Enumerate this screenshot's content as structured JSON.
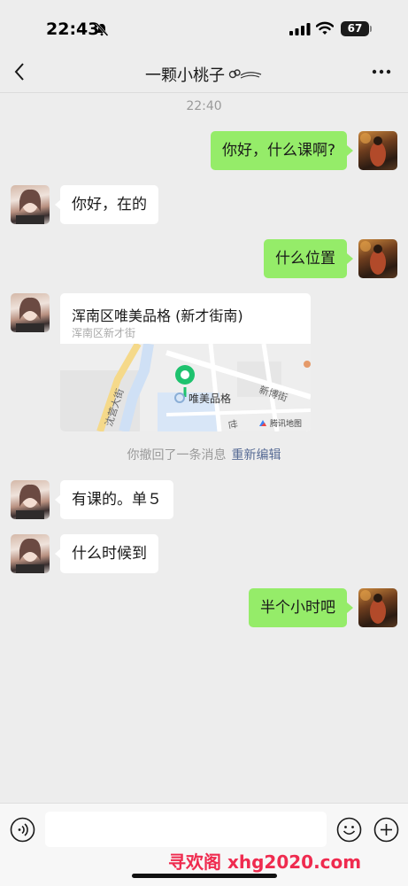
{
  "status_bar": {
    "time": "22:43",
    "battery": "67"
  },
  "nav": {
    "title": "一颗小桃子"
  },
  "chat": {
    "timestamp": "22:40",
    "messages": [
      {
        "from": "self",
        "text": "你好，什么课啊?"
      },
      {
        "from": "other",
        "text": "你好，在的"
      },
      {
        "from": "self",
        "text": "什么位置"
      },
      {
        "from": "other",
        "type": "location",
        "title": "浑南区唯美品格 (新才街南)",
        "subtitle": "浑南区新才街"
      },
      {
        "from": "other",
        "text": "有课的。单５"
      },
      {
        "from": "other",
        "text": "什么时候到"
      },
      {
        "from": "self",
        "text": "半个小时吧"
      }
    ],
    "recall_notice": "你撤回了一条消息",
    "recall_edit": "重新编辑"
  },
  "map": {
    "poi_label": "唯美品格",
    "street_labels": [
      "沈营大街",
      "新博街",
      "世"
    ],
    "attribution": "腾讯地图"
  },
  "input": {
    "placeholder": ""
  },
  "watermark": "寻欢阁 xhg2020.com",
  "colors": {
    "self_bubble": "#95ec69",
    "other_bubble": "#ffffff",
    "background": "#ededed",
    "link": "#576b95",
    "pin": "#1ec26e"
  },
  "icons": [
    "back-icon",
    "more-icon",
    "voice-icon",
    "emoji-icon",
    "plus-icon",
    "map-pin-icon",
    "mute-bell-icon",
    "signal-icon",
    "wifi-icon"
  ]
}
